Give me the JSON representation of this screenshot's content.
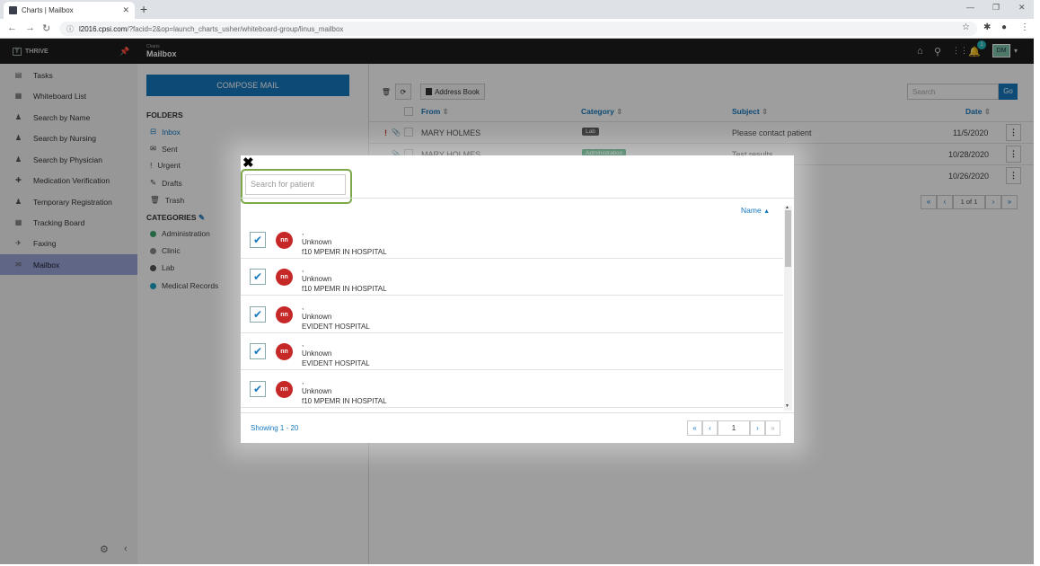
{
  "browser": {
    "tab_title": "Charts | Mailbox",
    "tab_close": "✕",
    "new_tab": "+",
    "url_host": "l2016.cpsi.com",
    "url_path": "/?facid=2&op=launch_charts_usher/whiteboard-group/linus_mailbox",
    "back": "←",
    "forward": "→",
    "reload": "↻",
    "lock": "ⓘ",
    "star": "☆",
    "extensions": "✱",
    "profile": "●",
    "menu": "⋮",
    "minimize": "—",
    "restore": "❐",
    "close": "✕"
  },
  "appbar": {
    "logo_text": "THRIVE",
    "logo_mark": "T",
    "pin": "📌",
    "title_small": "Charts",
    "title": "Mailbox",
    "home": "⌂",
    "search": "⚲",
    "grid": "⋮⋮",
    "bell": "🔔",
    "notification_count": "1",
    "avatar": "DM",
    "caret": "▾"
  },
  "sidebar": {
    "items": [
      {
        "label": "Tasks",
        "icon": "▤"
      },
      {
        "label": "Whiteboard List",
        "icon": "▦"
      },
      {
        "label": "Search by Name",
        "icon": "♟"
      },
      {
        "label": "Search by Nursing",
        "icon": "♟"
      },
      {
        "label": "Search by Physician",
        "icon": "♟"
      },
      {
        "label": "Medication Verification",
        "icon": "✚"
      },
      {
        "label": "Temporary Registration",
        "icon": "♟"
      },
      {
        "label": "Tracking Board",
        "icon": "▦"
      },
      {
        "label": "Faxing",
        "icon": "✈"
      },
      {
        "label": "Mailbox",
        "icon": "✉"
      }
    ],
    "settings": "⚙",
    "collapse": "‹"
  },
  "folders": {
    "compose": "COMPOSE MAIL",
    "folders_head": "FOLDERS",
    "items": [
      {
        "label": "Inbox",
        "icon": "⊟"
      },
      {
        "label": "Sent",
        "icon": "✉"
      },
      {
        "label": "Urgent",
        "icon": "!"
      },
      {
        "label": "Drafts",
        "icon": "✎"
      },
      {
        "label": "Trash",
        "icon": "🗑"
      }
    ],
    "categories_head": "CATEGORIES",
    "edit": "✎",
    "categories": [
      {
        "label": "Administration",
        "color": "#3aa86d"
      },
      {
        "label": "Clinic",
        "color": "#8a8a8a"
      },
      {
        "label": "Lab",
        "color": "#555555"
      },
      {
        "label": "Medical Records",
        "color": "#1aa3c9"
      }
    ]
  },
  "mail": {
    "trash": "🗑",
    "refresh": "⟳",
    "address_book": "Address Book",
    "search_placeholder": "Search",
    "go": "Go",
    "col_from": "From",
    "col_category": "Category",
    "col_subject": "Subject",
    "col_date": "Date",
    "sort": "⇕",
    "rows": [
      {
        "from": "MARY HOLMES",
        "category": "Lab",
        "subject": "Please contact patient",
        "date": "11/5/2020",
        "urgent": "!",
        "attach": "📎"
      },
      {
        "from": "MARY HOLMES",
        "category": "Administration",
        "subject": "Test results",
        "date": "10/28/2020",
        "urgent": "",
        "attach": "📎"
      },
      {
        "from": "",
        "category": "",
        "subject": "",
        "date": "10/26/2020",
        "urgent": "",
        "attach": ""
      }
    ],
    "kebab": "⋮",
    "pager": {
      "first": "«",
      "prev": "‹",
      "info": "1  of 1",
      "next": "›",
      "last": "»"
    }
  },
  "modal": {
    "close": "✖",
    "search_placeholder": "Search for patient",
    "sort_label": "Name",
    "sort_icon": "▲",
    "check": "✔",
    "patients": [
      {
        "initials": "nn",
        "name": ",",
        "status": "Unknown",
        "facility": "f10 MPEMR IN HOSPITAL"
      },
      {
        "initials": "nn",
        "name": ",",
        "status": "Unknown",
        "facility": "f10 MPEMR IN HOSPITAL"
      },
      {
        "initials": "nn",
        "name": ",",
        "status": "Unknown",
        "facility": "EVIDENT HOSPITAL"
      },
      {
        "initials": "nn",
        "name": ",",
        "status": "Unknown",
        "facility": "EVIDENT HOSPITAL"
      },
      {
        "initials": "nn",
        "name": ",",
        "status": "Unknown",
        "facility": "f10 MPEMR IN HOSPITAL"
      }
    ],
    "showing": "Showing 1 - 20",
    "pager": {
      "first": "«",
      "prev": "‹",
      "page": "1",
      "next": "›",
      "last": "»"
    },
    "scroll_up": "▲",
    "scroll_down": "▼"
  }
}
